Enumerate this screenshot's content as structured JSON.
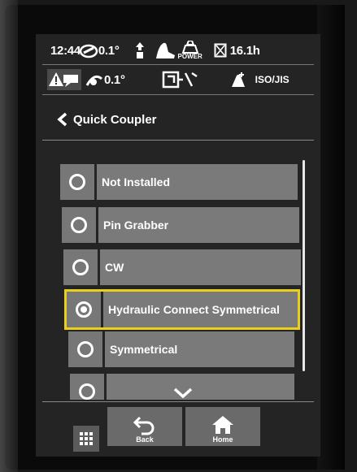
{
  "status": {
    "time": "12:44",
    "angle_top": "0.1°",
    "power_label": "POWER",
    "hours": "16.1h",
    "angle_bottom": "0.1°",
    "pattern": "ISO/JIS"
  },
  "title": {
    "text": "Quick Coupler"
  },
  "options": [
    {
      "label": "Not Installed",
      "selected": false
    },
    {
      "label": "Pin Grabber",
      "selected": false
    },
    {
      "label": "CW",
      "selected": false
    },
    {
      "label": "Hydraulic Connect Symmetrical",
      "selected": true
    },
    {
      "label": "Symmetrical",
      "selected": false
    }
  ],
  "nav": {
    "back_label": "Back",
    "home_label": "Home"
  },
  "colors": {
    "selected_outline": "#e9d01d",
    "option_bg": "#7a7a7a",
    "screen_bg": "#242424"
  }
}
